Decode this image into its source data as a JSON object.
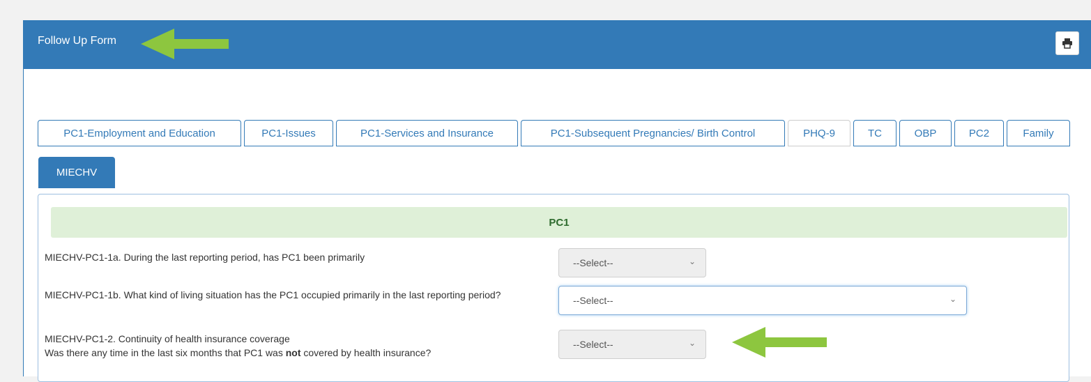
{
  "header": {
    "title": "Follow Up Form",
    "print_icon": "printer-icon"
  },
  "tabs": [
    {
      "label": "PC1-Employment and Education"
    },
    {
      "label": "PC1-Issues"
    },
    {
      "label": "PC1-Services and Insurance"
    },
    {
      "label": "PC1-Subsequent Pregnancies/ Birth Control"
    },
    {
      "label": "PHQ-9"
    },
    {
      "label": "TC"
    },
    {
      "label": "OBP"
    },
    {
      "label": "PC2"
    },
    {
      "label": "Family"
    },
    {
      "label": "MIECHV"
    }
  ],
  "section": {
    "title": "PC1"
  },
  "questions": [
    {
      "text": "MIECHV-PC1-1a. During the last reporting period, has PC1 been primarily",
      "select_value": "--Select--"
    },
    {
      "text": "MIECHV-PC1-1b. What kind of living situation has the PC1 occupied primarily in the last reporting period?",
      "select_value": "--Select--"
    },
    {
      "line1": "MIECHV-PC1-2. Continuity of health insurance coverage",
      "line2_pre": "Was there any time in the last six months that PC1 was ",
      "line2_bold": "not",
      "line2_post": " covered by health insurance?",
      "select_value": "--Select--"
    }
  ],
  "colors": {
    "header": "#337ab7",
    "section_bg": "#dff0d8",
    "arrow": "#8dc63f"
  }
}
